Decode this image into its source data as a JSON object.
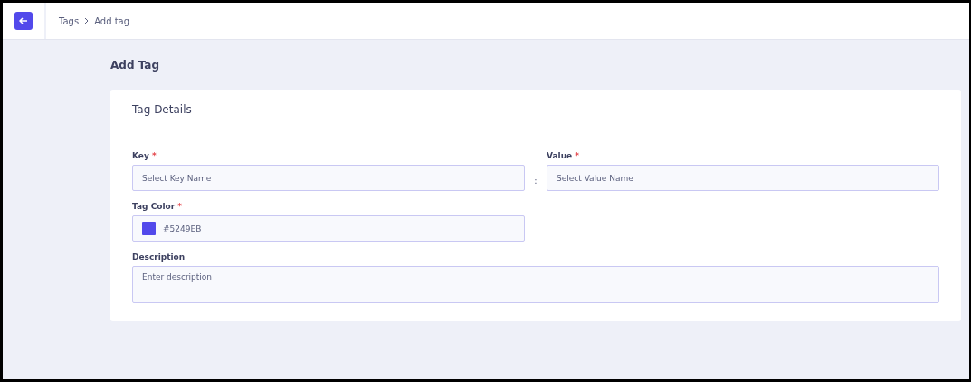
{
  "breadcrumb": [
    "Tags",
    "Add tag"
  ],
  "page_title": "Add Tag",
  "card": {
    "title": "Tag Details",
    "key": {
      "label": "Key",
      "marker": "*",
      "placeholder": "Select Key Name"
    },
    "separator": ":",
    "value": {
      "label": "Value",
      "marker": "*",
      "placeholder": "Select Value Name"
    },
    "tag_color": {
      "label": "Tag Color",
      "marker": "*",
      "value": "#5249EB",
      "color": "#5249eb"
    },
    "description": {
      "label": "Description",
      "placeholder": "Enter description"
    }
  }
}
